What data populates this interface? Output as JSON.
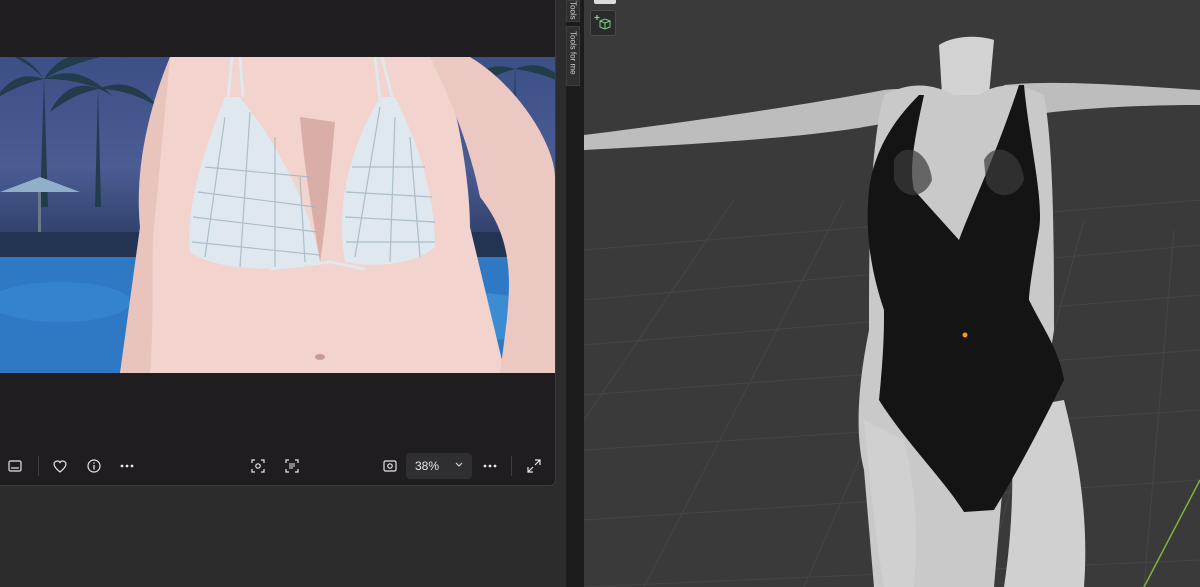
{
  "viewer": {
    "zoom_value": "38%",
    "toolbar_icons": [
      "filmstrip-icon",
      "heart-icon",
      "info-icon",
      "more-icon",
      "focus-icon",
      "ocr-icon",
      "fit-icon",
      "more-icon",
      "fullscreen-icon"
    ]
  },
  "sidebar_tabs": {
    "tools_label": "Tools",
    "tools_for_me_label": "Tools for me"
  },
  "colors": {
    "viewer_bg": "#1f1d1f",
    "viewport_bg": "#3a3a3a",
    "origin_dot": "#f59a1b",
    "y_axis_line": "#7fb33a"
  }
}
